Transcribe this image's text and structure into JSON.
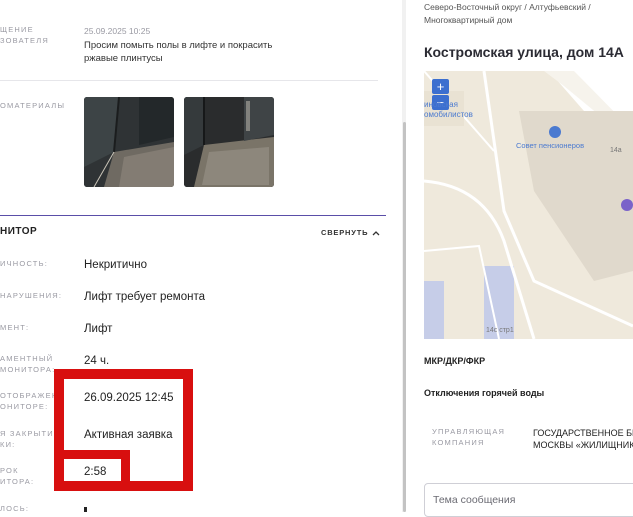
{
  "left": {
    "author": {
      "label_line1": "ЩЕНИЕ",
      "label_line2": "ЗОВАТЕЛЯ",
      "date": "25.09.2025 10:25",
      "text_line1": "Просим помыть полы в лифте и покрасить",
      "text_line2": "ржавые плинтусы"
    },
    "photos_label": "ОМАТЕРИАЛЫ",
    "monitor": {
      "title": "НИТОР",
      "collapse_label": "СВЕРНУТЬ",
      "rows": [
        {
          "label_line1": "ИЧНОСТЬ:",
          "label_line2": "",
          "value": "Некритично"
        },
        {
          "label_line1": "НАРУШЕНИЯ:",
          "label_line2": "",
          "value": "Лифт требует ремонта"
        },
        {
          "label_line1": "МЕНТ:",
          "label_line2": "",
          "value": "Лифт"
        },
        {
          "label_line1": "АМЕНТНЫЙ",
          "label_line2": "МОНИТОРА:",
          "value": "24 ч."
        },
        {
          "label_line1": "ОТОБРАЖЕН",
          "label_line2": "ОНИТОРЕ:",
          "value": "26.09.2025 12:45"
        },
        {
          "label_line1": "Я ЗАКРЫТИЯ",
          "label_line2": "КИ:",
          "value": "Активная заявка"
        },
        {
          "label_line1": "РОК",
          "label_line2": "ИТОРА:",
          "value": "2:58"
        },
        {
          "label_line1": "ЛОСЬ:",
          "label_line2": "",
          "value": ""
        }
      ]
    }
  },
  "right": {
    "breadcrumb_line1": "Северо-Восточный округ / Алтуфьевский /",
    "breadcrumb_line2": "Многоквартирный дом",
    "address_title": "Костромская улица, дом 14А",
    "map": {
      "label_school_line1": "иновская",
      "label_school_line2": "омобилистов",
      "poi": "Совет пенсионеров",
      "building_14a": "14а",
      "building_14c": "14с стр1",
      "zoom_in": "+",
      "zoom_out": "−"
    },
    "program_label": "МКР/ДКР/ФКР",
    "hot_water_label": "Отключения горячей воды",
    "company_label_line1": "УПРАВЛЯЮЩАЯ",
    "company_label_line2": "КОМПАНИЯ",
    "company_value_line1": "ГОСУДАРСТВЕННОЕ БК",
    "company_value_line2": "МОСКВЫ «ЖИЛИЩНИК",
    "message_placeholder": "Тема сообщения"
  },
  "colors": {
    "accent_divider": "#5a4ea8",
    "highlight_red": "#d80f0f",
    "map_button": "#3c6fcf",
    "poi_blue": "#4b7ad0",
    "marker_purple": "#7b63c9"
  }
}
